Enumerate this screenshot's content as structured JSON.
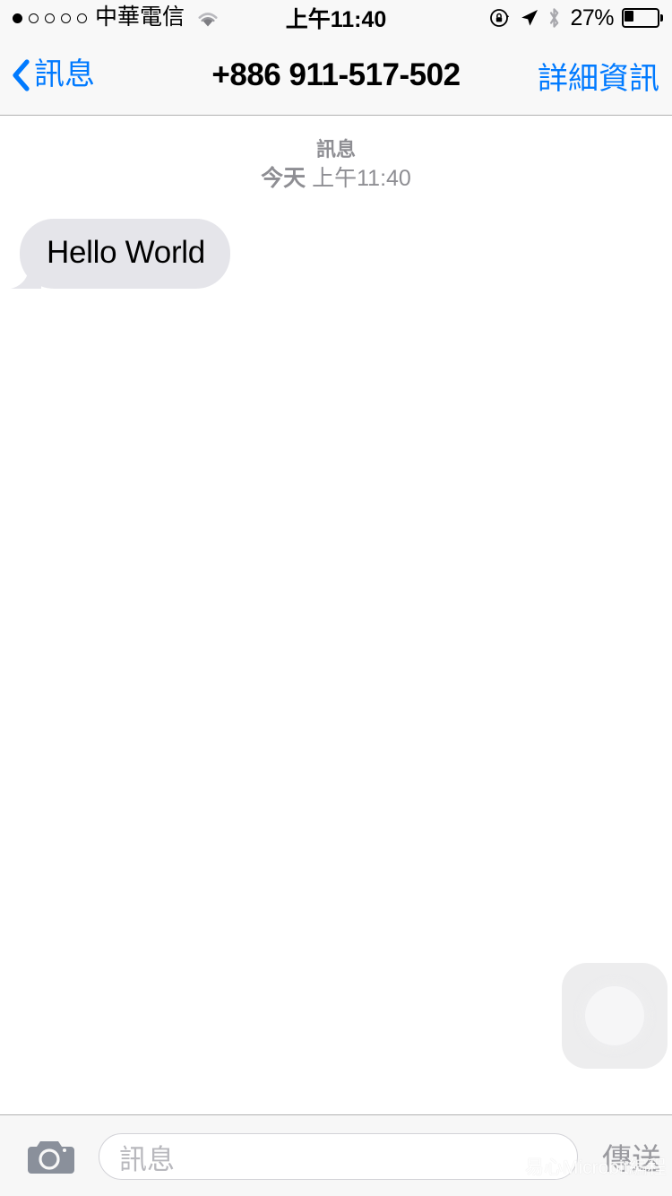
{
  "status_bar": {
    "signal_dots_total": 5,
    "signal_dots_filled": 1,
    "carrier": "中華電信",
    "wifi_icon": "wifi-icon",
    "time": "上午11:40",
    "rotation_lock_icon": "rotation-lock-icon",
    "location_icon": "location-arrow-icon",
    "bluetooth_icon": "bluetooth-icon",
    "battery_percent": "27%",
    "battery_level": 27,
    "battery_icon": "battery-icon"
  },
  "nav_bar": {
    "back_icon": "chevron-left-icon",
    "back_label": "訊息",
    "title": "+886 911-517-502",
    "right_button": "詳細資訊",
    "accent_color": "#007aff",
    "background_color": "#f8f8f8"
  },
  "conversation": {
    "timestamp_label": "訊息",
    "timestamp_day": "今天",
    "timestamp_time": "上午11:40",
    "messages": [
      {
        "text": "Hello World",
        "side": "incoming",
        "bubble_color": "#e5e5ea",
        "text_color": "#000000"
      }
    ]
  },
  "assistive_touch": {
    "name": "assistive-touch-button",
    "visible": true
  },
  "bottom_bar": {
    "camera_icon": "camera-icon",
    "input_placeholder": "訊息",
    "input_value": "",
    "send_label": "傳送",
    "send_color": "#9a9a9f",
    "background_color": "#f7f7f7"
  },
  "watermark": {
    "logo_icon": "brand-logo-icon",
    "text": "易心Microbit編程"
  }
}
